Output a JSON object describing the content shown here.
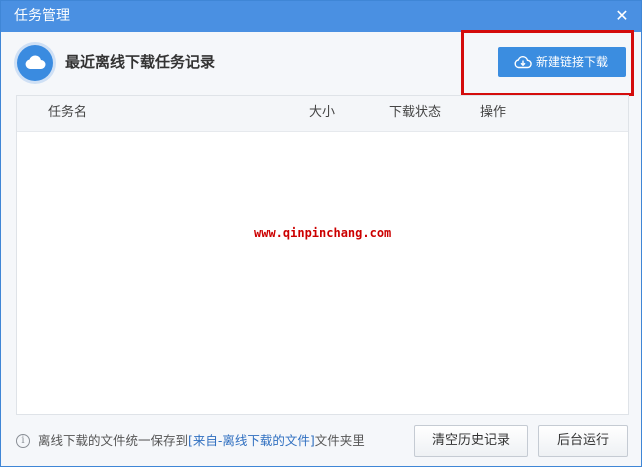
{
  "window": {
    "title": "任务管理",
    "close_glyph": "✕"
  },
  "header": {
    "title": "最近离线下载任务记录",
    "icon": "cloud-icon",
    "new_button_label": "新建链接下载",
    "new_button_icon": "cloud-download-icon"
  },
  "table": {
    "columns": [
      "任务名",
      "大小",
      "下载状态",
      "操作"
    ],
    "rows": [],
    "watermark": "www.qinpinchang.com"
  },
  "footer": {
    "note_prefix": "离线下载的文件统一保存到",
    "note_link": "[来自-离线下载的文件]",
    "note_suffix": "文件夹里",
    "info_icon": "info-icon",
    "clear_button": "清空历史记录",
    "background_button": "后台运行"
  },
  "colors": {
    "titlebar": "#4a90e2",
    "primary_button": "#3b8de0",
    "highlight_box": "#d40c0c",
    "link": "#2f6fc0"
  }
}
